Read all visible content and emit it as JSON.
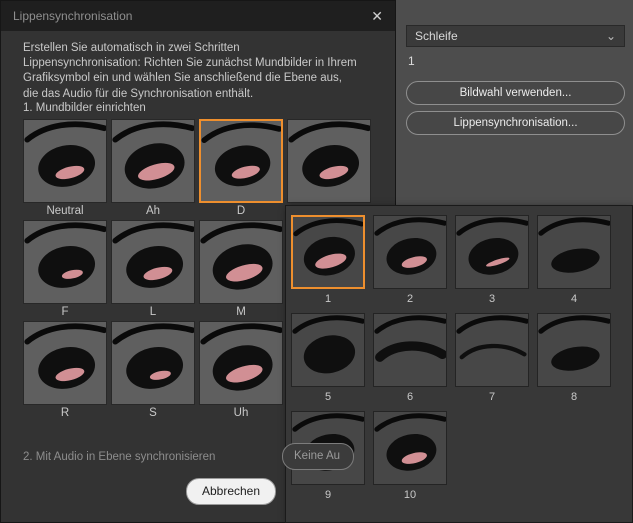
{
  "colors": {
    "accent_orange": "#ee8f2e",
    "tongue_pink": "#d18f94",
    "dialog_bg": "#333333",
    "panel_bg": "#4d4d4d",
    "flyout_bg": "#383838"
  },
  "icons": {
    "close": "✕",
    "dropdown_chevron": "⌄"
  },
  "dialog": {
    "title": "Lippensynchronisation",
    "description": "Erstellen Sie automatisch in zwei Schritten Lippensynchronisation: Richten Sie zunächst Mundbilder in Ihrem Grafiksymbol ein und wählen Sie anschließend die Ebene aus, die das Audio für die Synchronisation enthält.",
    "section1_heading": "1. Mundbilder einrichten",
    "section2_heading": "2. Mit Audio in Ebene synchronisieren",
    "audio_button_label": "Keine Au",
    "cancel_button_label": "Abbrechen",
    "mouths": [
      {
        "label": "Neutral",
        "variant": "open-tongue-medium",
        "selected": false
      },
      {
        "label": "Ah",
        "variant": "open-tongue-large",
        "selected": false
      },
      {
        "label": "D",
        "variant": "open-tongue-medium",
        "selected": true
      },
      {
        "label": "",
        "variant": "open-tongue-medium",
        "selected": false
      },
      {
        "label": "F",
        "variant": "open-tongue-small",
        "selected": false
      },
      {
        "label": "L",
        "variant": "open-tongue-medium",
        "selected": false
      },
      {
        "label": "M",
        "variant": "open-tongue-large",
        "selected": false
      },
      {
        "label": "",
        "variant": "open-tongue-medium",
        "selected": false
      },
      {
        "label": "R",
        "variant": "open-tongue-medium",
        "selected": false
      },
      {
        "label": "S",
        "variant": "open-tongue-small",
        "selected": false
      },
      {
        "label": "Uh",
        "variant": "open-tongue-large",
        "selected": false
      },
      {
        "label": "",
        "variant": "open-tongue-medium",
        "selected": false
      }
    ]
  },
  "properties_panel": {
    "loop_select_value": "Schleife",
    "frame_value": "1",
    "frame_picker_button_label": "Bildwahl verwenden...",
    "lipsync_button_label": "Lippensynchronisation..."
  },
  "frame_picker": {
    "frames": [
      {
        "number": "1",
        "variant": "open-tongue-large",
        "selected": true
      },
      {
        "number": "2",
        "variant": "open-tongue-medium",
        "selected": false
      },
      {
        "number": "3",
        "variant": "open-tongue-thin",
        "selected": false
      },
      {
        "number": "4",
        "variant": "half-open",
        "selected": false
      },
      {
        "number": "5",
        "variant": "open-dark",
        "selected": false
      },
      {
        "number": "6",
        "variant": "closed-heavy",
        "selected": false
      },
      {
        "number": "7",
        "variant": "closed-thin",
        "selected": false
      },
      {
        "number": "8",
        "variant": "half-open",
        "selected": false
      },
      {
        "number": "9",
        "variant": "open-tongue-small",
        "selected": false
      },
      {
        "number": "10",
        "variant": "open-tongue-medium",
        "selected": false
      }
    ]
  }
}
